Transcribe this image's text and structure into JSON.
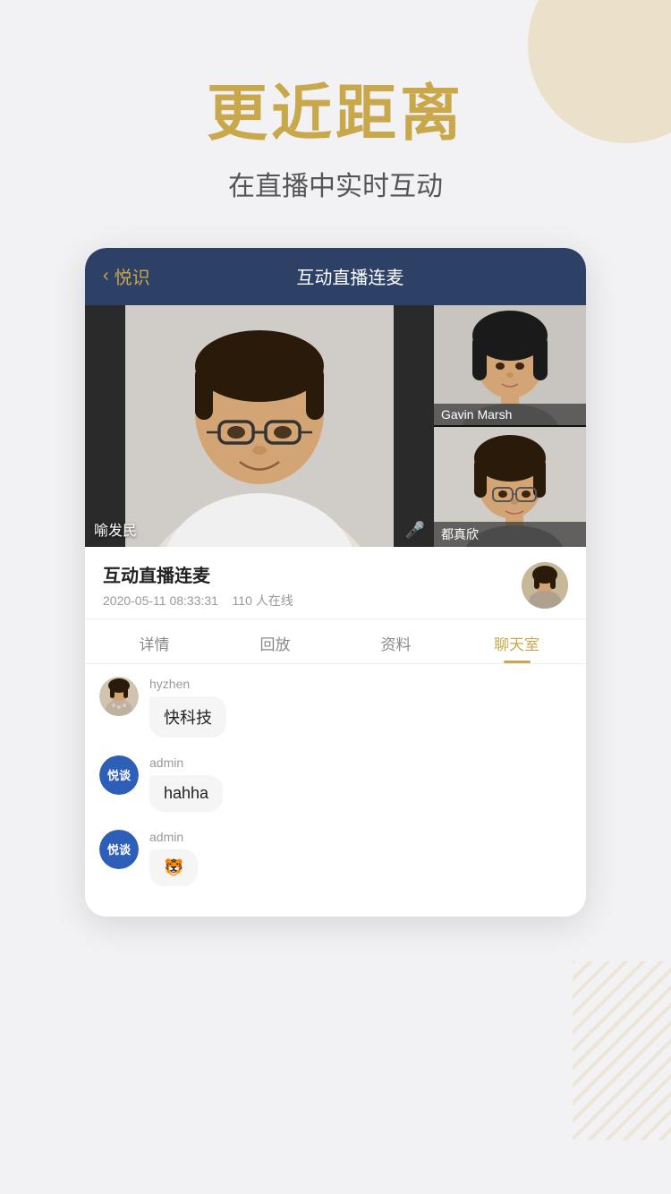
{
  "background": {
    "color": "#f2f2f5"
  },
  "header": {
    "main_title": "更近距离",
    "sub_title": "在直播中实时互动"
  },
  "nav": {
    "back_label": "〈",
    "app_name": "悦识",
    "title": "互动直播连麦"
  },
  "video": {
    "main_person_name": "喻发民",
    "side_person_1": "Gavin Marsh",
    "side_person_2": "都真欣"
  },
  "info": {
    "title": "互动直播连麦",
    "date": "2020-05-11 08:33:31",
    "online": "110 人在线"
  },
  "tabs": [
    {
      "label": "详情",
      "active": false
    },
    {
      "label": "回放",
      "active": false
    },
    {
      "label": "资料",
      "active": false
    },
    {
      "label": "聊天室",
      "active": true
    }
  ],
  "chat": {
    "messages": [
      {
        "username": "hyzhen",
        "text": "快科技",
        "avatar_type": "photo"
      },
      {
        "username": "admin",
        "text": "hahha",
        "avatar_type": "logo"
      },
      {
        "username": "admin",
        "text": "🐯",
        "avatar_type": "logo"
      }
    ]
  },
  "icons": {
    "mic": "🎤",
    "back_chevron": "‹"
  }
}
